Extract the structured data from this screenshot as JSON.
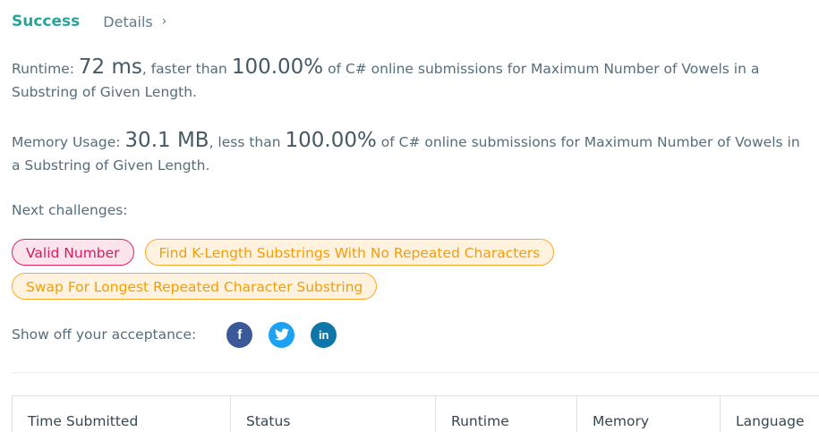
{
  "header": {
    "status": "Success",
    "details_label": "Details",
    "chevron": "›"
  },
  "runtime": {
    "prefix": "Runtime: ",
    "value": "72 ms",
    "mid": ", faster than ",
    "percent": "100.00%",
    "suffix": " of C# online submissions for Maximum Number of Vowels in a Substring of Given Length."
  },
  "memory": {
    "prefix": "Memory Usage: ",
    "value": "30.1 MB",
    "mid": ", less than ",
    "percent": "100.00%",
    "suffix": " of C# online submissions for Maximum Number of Vowels in a Substring of Given Length."
  },
  "next_challenges": {
    "label": "Next challenges:",
    "items": [
      {
        "label": "Valid Number",
        "difficulty_color": "#e91e63"
      },
      {
        "label": "Find K-Length Substrings With No Repeated Characters",
        "difficulty_color": "#ffa726"
      },
      {
        "label": "Swap For Longest Repeated Character Substring",
        "difficulty_color": "#ffa726"
      }
    ]
  },
  "share": {
    "label": "Show off your acceptance:",
    "icons": [
      {
        "name": "facebook-icon",
        "glyph": "f",
        "color": "#3b5998"
      },
      {
        "name": "twitter-icon",
        "glyph": "🐦",
        "color": "#1da1f2"
      },
      {
        "name": "linkedin-icon",
        "glyph": "in",
        "color": "#0e76a8"
      }
    ]
  },
  "table": {
    "columns": [
      "Time Submitted",
      "Status",
      "Runtime",
      "Memory",
      "Language"
    ]
  }
}
